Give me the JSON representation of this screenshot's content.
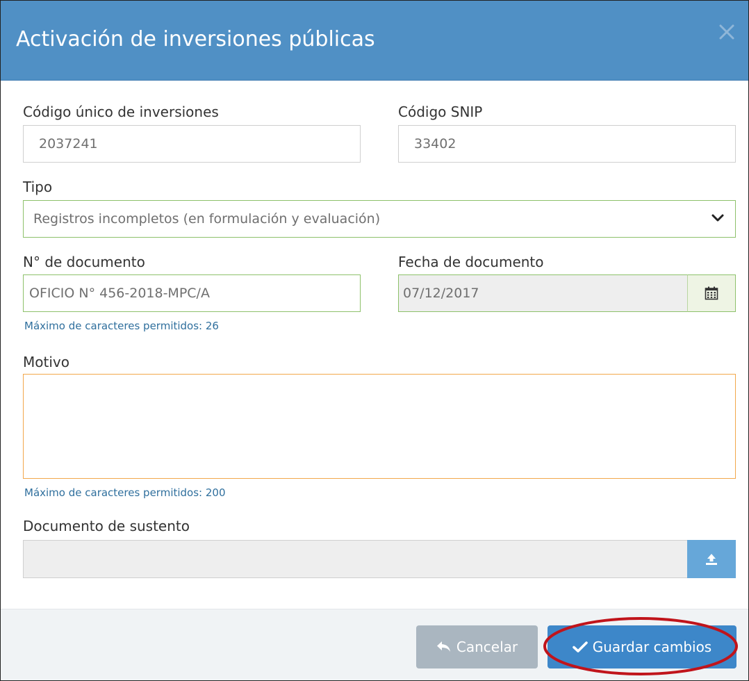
{
  "modal": {
    "title": "Activación de inversiones públicas",
    "close_icon": "close-icon"
  },
  "form": {
    "codigo_unico": {
      "label": "Código único de inversiones",
      "value": "2037241"
    },
    "codigo_snip": {
      "label": "Código SNIP",
      "value": "33402"
    },
    "tipo": {
      "label": "Tipo",
      "value": "Registros incompletos (en formulación y evaluación)"
    },
    "nro_documento": {
      "label": "N° de documento",
      "value": "OFICIO N° 456-2018-MPC/A",
      "help": "Máximo de caracteres permitidos: 26"
    },
    "fecha_documento": {
      "label": "Fecha de documento",
      "value": "07/12/2017",
      "icon": "calendar-icon"
    },
    "motivo": {
      "label": "Motivo",
      "value": "",
      "help": "Máximo de caracteres permitidos: 200"
    },
    "documento_sustento": {
      "label": "Documento de sustento",
      "value": "",
      "icon": "upload-icon"
    }
  },
  "footer": {
    "cancel_label": "Cancelar",
    "save_label": "Guardar cambios"
  },
  "colors": {
    "header": "#5090c5",
    "valid_border": "#8dc16a",
    "focus_border": "#f2a74b",
    "primary_button": "#3d87c9",
    "secondary_button": "#aab6c0",
    "highlight_ring": "#c0141b"
  }
}
